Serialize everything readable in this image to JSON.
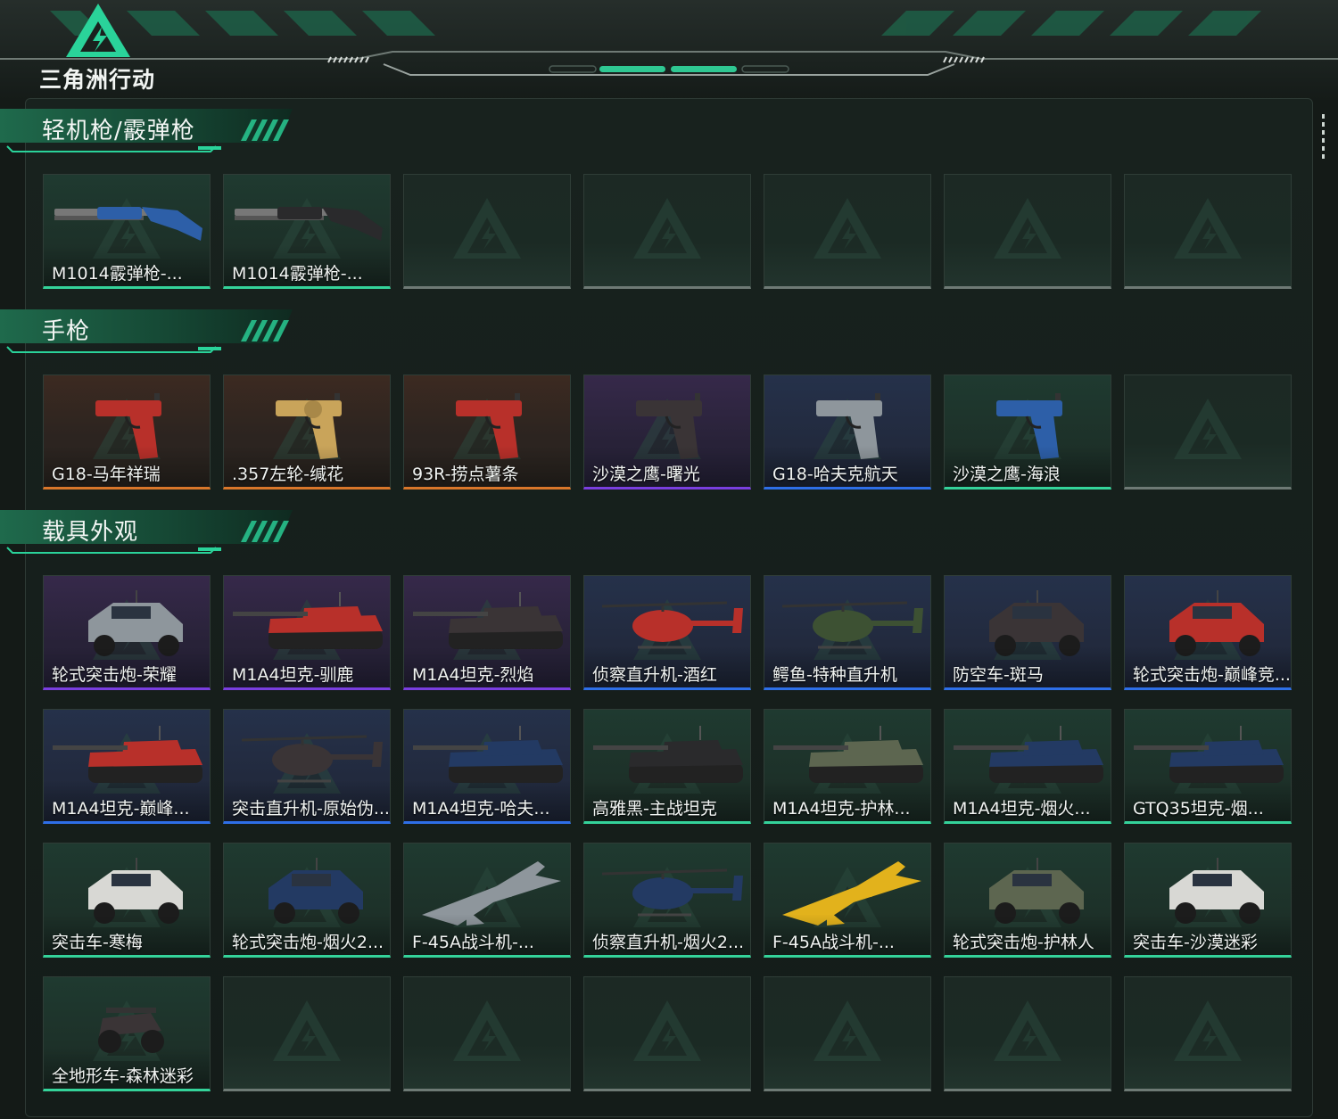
{
  "header": {
    "logo_title": "三角洲行动"
  },
  "colors": {
    "accent_green": "#2ad39a",
    "rarity_gold": "#d9762a",
    "rarity_purple": "#7a3ee0",
    "rarity_blue": "#2e6fe8",
    "rarity_green": "#34d39a",
    "empty_slot": "#6e7a75"
  },
  "sections": [
    {
      "title": "轻机枪/霰弹枪",
      "items": [
        {
          "label": "M1014霰弹枪-...",
          "rarity": "green",
          "icon": "shotgun-icon",
          "tint": "blue"
        },
        {
          "label": "M1014霰弹枪-...",
          "rarity": "green",
          "icon": "shotgun-icon",
          "tint": "black"
        },
        {
          "label": "",
          "rarity": "empty"
        },
        {
          "label": "",
          "rarity": "empty"
        },
        {
          "label": "",
          "rarity": "empty"
        },
        {
          "label": "",
          "rarity": "empty"
        },
        {
          "label": "",
          "rarity": "empty"
        }
      ]
    },
    {
      "title": "手枪",
      "items": [
        {
          "label": "G18-马年祥瑞",
          "rarity": "gold",
          "icon": "pistol-icon",
          "tint": "red"
        },
        {
          "label": ".357左轮-缄花",
          "rarity": "gold",
          "icon": "revolver-icon",
          "tint": "gold"
        },
        {
          "label": "93R-捞点薯条",
          "rarity": "gold",
          "icon": "pistol-icon",
          "tint": "red"
        },
        {
          "label": "沙漠之鹰-曙光",
          "rarity": "purple",
          "icon": "pistol-icon",
          "tint": "dark"
        },
        {
          "label": "G18-哈夫克航天",
          "rarity": "blue",
          "icon": "pistol-icon",
          "tint": "grey"
        },
        {
          "label": "沙漠之鹰-海浪",
          "rarity": "green",
          "icon": "pistol-icon",
          "tint": "blue"
        },
        {
          "label": "",
          "rarity": "empty"
        }
      ]
    },
    {
      "title": "载具外观",
      "items": [
        {
          "label": "轮式突击炮-荣耀",
          "rarity": "purple",
          "icon": "armored-car-icon",
          "tint": "grey"
        },
        {
          "label": "M1A4坦克-驯鹿",
          "rarity": "purple",
          "icon": "tank-icon",
          "tint": "red"
        },
        {
          "label": "M1A4坦克-烈焰",
          "rarity": "purple",
          "icon": "tank-icon",
          "tint": "dark"
        },
        {
          "label": "侦察直升机-酒红",
          "rarity": "blue",
          "icon": "helicopter-icon",
          "tint": "red"
        },
        {
          "label": "鳄鱼-特种直升机",
          "rarity": "blue",
          "icon": "helicopter-icon",
          "tint": "olive"
        },
        {
          "label": "防空车-斑马",
          "rarity": "blue",
          "icon": "armored-car-icon",
          "tint": "dark"
        },
        {
          "label": "轮式突击炮-巅峰竞...",
          "rarity": "blue",
          "icon": "armored-car-icon",
          "tint": "red"
        },
        {
          "label": "M1A4坦克-巅峰...",
          "rarity": "blue",
          "icon": "tank-icon",
          "tint": "red"
        },
        {
          "label": "突击直升机-原始伪...",
          "rarity": "blue",
          "icon": "helicopter-icon",
          "tint": "dark"
        },
        {
          "label": "M1A4坦克-哈夫...",
          "rarity": "blue",
          "icon": "tank-icon",
          "tint": "navy"
        },
        {
          "label": "高雅黑-主战坦克",
          "rarity": "green",
          "icon": "tank-icon",
          "tint": "black"
        },
        {
          "label": "M1A4坦克-护林...",
          "rarity": "green",
          "icon": "tank-icon",
          "tint": "camo"
        },
        {
          "label": "M1A4坦克-烟火...",
          "rarity": "green",
          "icon": "tank-icon",
          "tint": "navy"
        },
        {
          "label": "GTQ35坦克-烟...",
          "rarity": "green",
          "icon": "tank-icon",
          "tint": "navy"
        },
        {
          "label": "突击车-寒梅",
          "rarity": "green",
          "icon": "armored-car-icon",
          "tint": "white"
        },
        {
          "label": "轮式突击炮-烟火2...",
          "rarity": "green",
          "icon": "armored-car-icon",
          "tint": "navy"
        },
        {
          "label": "F-45A战斗机-...",
          "rarity": "green",
          "icon": "fighter-jet-icon",
          "tint": "grey"
        },
        {
          "label": "侦察直升机-烟火2...",
          "rarity": "green",
          "icon": "helicopter-icon",
          "tint": "navy"
        },
        {
          "label": "F-45A战斗机-...",
          "rarity": "green",
          "icon": "fighter-jet-icon",
          "tint": "yellow"
        },
        {
          "label": "轮式突击炮-护林人",
          "rarity": "green",
          "icon": "armored-car-icon",
          "tint": "camo"
        },
        {
          "label": "突击车-沙漠迷彩",
          "rarity": "green",
          "icon": "armored-car-icon",
          "tint": "white"
        },
        {
          "label": "全地形车-森林迷彩",
          "rarity": "green",
          "icon": "atv-icon",
          "tint": "dark"
        },
        {
          "label": "",
          "rarity": "empty"
        },
        {
          "label": "",
          "rarity": "empty"
        },
        {
          "label": "",
          "rarity": "empty"
        },
        {
          "label": "",
          "rarity": "empty"
        },
        {
          "label": "",
          "rarity": "empty"
        },
        {
          "label": "",
          "rarity": "empty"
        }
      ]
    }
  ]
}
